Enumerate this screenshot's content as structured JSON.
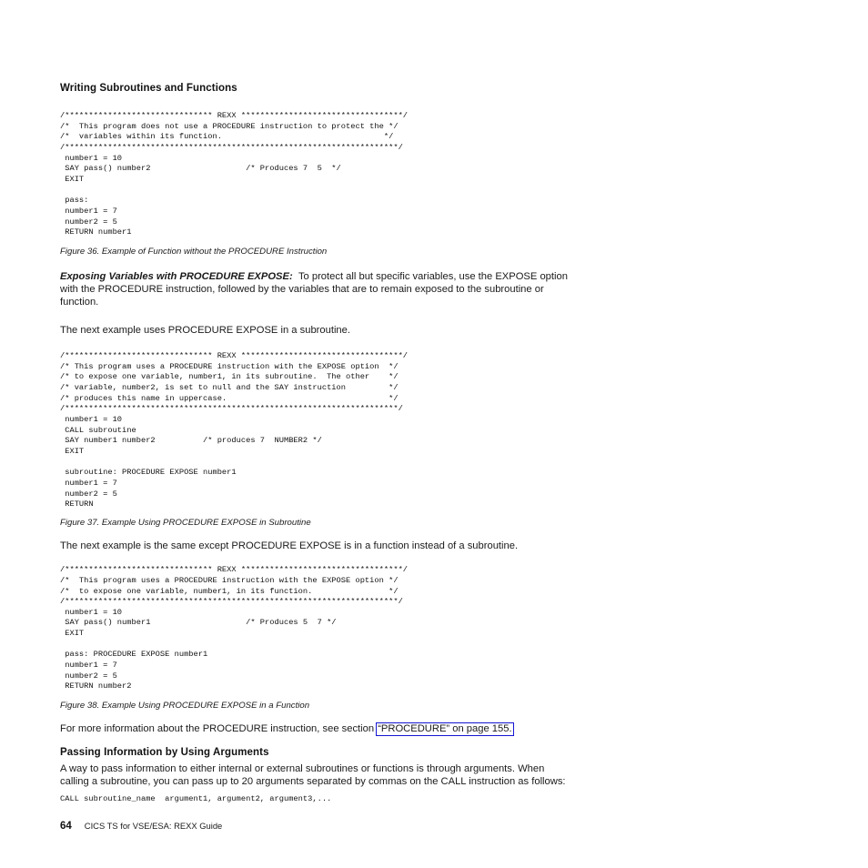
{
  "document": {
    "title": "CICS TS for VSE/ESA:  REXX Guide",
    "page_number": "64"
  },
  "sections": {
    "writing_subroutines_heading": "Writing Subroutines and Functions",
    "passing_info_heading": "Passing Information by Using Arguments"
  },
  "figures": [
    {
      "code": "/******************************* REXX **********************************/\n/*  This program does not use a PROCEDURE instruction to protect the */\n/*  variables within its function.                                  */\n/**********************************************************************/\n number1 = 10\n SAY pass() number2                    /* Produces 7  5  */\n EXIT\n\n pass:\n number1 = 7\n number2 = 5\n RETURN number1",
      "caption": "Figure 36. Example of Function without the PROCEDURE Instruction"
    },
    {
      "code": "/******************************* REXX **********************************/\n/* This program uses a PROCEDURE instruction with the EXPOSE option  */\n/* to expose one variable, number1, in its subroutine.  The other    */\n/* variable, number2, is set to null and the SAY instruction         */\n/* produces this name in uppercase.                                  */\n/**********************************************************************/\n number1 = 10\n CALL subroutine\n SAY number1 number2          /* produces 7  NUMBER2 */\n EXIT\n\n subroutine: PROCEDURE EXPOSE number1\n number1 = 7\n number2 = 5\n RETURN",
      "caption": "Figure 37. Example Using PROCEDURE EXPOSE in Subroutine"
    },
    {
      "code": "/******************************* REXX **********************************/\n/*  This program uses a PROCEDURE instruction with the EXPOSE option */\n/*  to expose one variable, number1, in its function.                */\n/**********************************************************************/\n number1 = 10\n SAY pass() number1                    /* Produces 5  7 */\n EXIT\n\n pass: PROCEDURE EXPOSE number1\n number1 = 7\n number2 = 5\n RETURN number2",
      "caption": "Figure 38. Example Using PROCEDURE EXPOSE in a Function"
    }
  ],
  "paragraphs": {
    "expose_runin_title": "Exposing Variables with PROCEDURE EXPOSE:",
    "expose_body": "To protect all but specific variables, use the EXPOSE option with the PROCEDURE instruction, followed by the variables that are to remain exposed to the subroutine or function.",
    "next_example_subroutine": "The next example uses PROCEDURE EXPOSE in a subroutine.",
    "next_example_function": "The next example is the same except PROCEDURE EXPOSE is in a function instead of a subroutine.",
    "more_info_prefix": "For more information about the PROCEDURE instruction, see section ",
    "more_info_link": "“PROCEDURE” on page 155.",
    "passing_info_body": "A way to pass information to either internal or external subroutines or functions is through arguments. When calling a subroutine, you can pass up to 20 arguments separated by commas on the CALL instruction as follows:",
    "call_syntax": "CALL subroutine_name  argument1, argument2, argument3,..."
  },
  "colors": {
    "text": "#1a1a1a",
    "link_border": "#1414d2",
    "page_background": "#ffffff"
  }
}
